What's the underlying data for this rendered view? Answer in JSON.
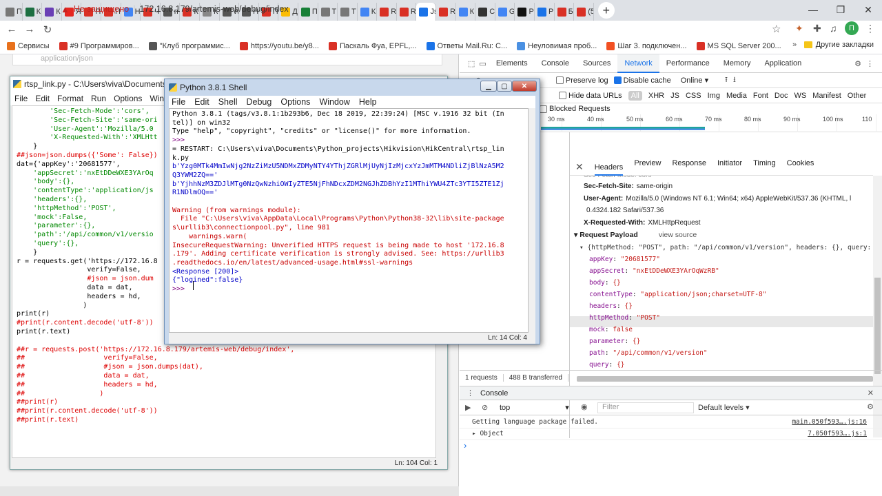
{
  "browser": {
    "tabs": [
      {
        "label": "П",
        "color": "#777"
      },
      {
        "label": "К",
        "color": "#1d6f42"
      },
      {
        "label": "К",
        "color": "#6a3fb5"
      },
      {
        "label": "Я",
        "color": "#e52620"
      },
      {
        "label": "П",
        "color": "#d93025"
      },
      {
        "label": "П",
        "color": "#d93025"
      },
      {
        "label": "Н",
        "color": "#4285f4"
      },
      {
        "label": "Ч",
        "color": "#d93025"
      },
      {
        "label": "п",
        "color": "#555"
      },
      {
        "label": "К",
        "color": "#d93025"
      },
      {
        "label": "К",
        "color": "#888"
      },
      {
        "label": "W",
        "color": "#555"
      },
      {
        "label": "Н",
        "color": "#555"
      },
      {
        "label": "П",
        "color": "#d93025"
      },
      {
        "label": "Д",
        "color": "#fbbc04"
      },
      {
        "label": "П",
        "color": "#188038"
      },
      {
        "label": "Т",
        "color": "#777"
      },
      {
        "label": "Т",
        "color": "#777"
      },
      {
        "label": "К",
        "color": "#4285f4"
      },
      {
        "label": "R",
        "color": "#d93025"
      },
      {
        "label": "R",
        "color": "#d93025"
      },
      {
        "label": "Js",
        "color": "#1a73e8"
      },
      {
        "label": "Ri",
        "color": "#d93025"
      },
      {
        "label": "К",
        "color": "#4285f4"
      },
      {
        "label": "С",
        "color": "#333"
      },
      {
        "label": "G",
        "color": "#4285f4"
      },
      {
        "label": "Р",
        "color": "#111"
      },
      {
        "label": "Р",
        "color": "#1a73e8"
      },
      {
        "label": "Б",
        "color": "#d93025"
      },
      {
        "label": "(5",
        "color": "#d93025"
      }
    ],
    "active_tab_index": 21,
    "new_tab_label": "+",
    "win_min": "—",
    "win_max": "❐",
    "win_close": "✕",
    "address": {
      "security_label": "Не защищено",
      "url": "172.16.8.179/artemis-web/debug/index"
    },
    "avatar_letter": "П",
    "bookmarks": [
      {
        "label": "Сервисы",
        "color": "#e8711c"
      },
      {
        "label": "#9 Программиров...",
        "color": "#d93025"
      },
      {
        "label": "\"Клуб программис...",
        "color": "#555"
      },
      {
        "label": "https://youtu.be/y8...",
        "color": "#d93025"
      },
      {
        "label": "Паскаль Фуа, EPFL,...",
        "color": "#d93025"
      },
      {
        "label": "Ответы Mail.Ru: С...",
        "color": "#1a73e8"
      },
      {
        "label": "Неуловимая проб...",
        "color": "#4a90e2"
      },
      {
        "label": "Шаг 3. подключен...",
        "color": "#f25022"
      },
      {
        "label": "MS SQL Server 200...",
        "color": "#d93025"
      }
    ],
    "other_bookmarks": "Другие закладки",
    "page_field_text": "application/json"
  },
  "devtools": {
    "tabs": [
      "Elements",
      "Console",
      "Sources",
      "Network",
      "Performance",
      "Memory",
      "Application"
    ],
    "active_tab": "Network",
    "preserve_log": "Preserve log",
    "disable_cache": "Disable cache",
    "throttle": "Online",
    "hide_data_urls": "Hide data URLs",
    "all": "All",
    "filters": [
      "XHR",
      "JS",
      "CSS",
      "Img",
      "Media",
      "Font",
      "Doc",
      "WS",
      "Manifest",
      "Other"
    ],
    "blocked_requests": "Blocked Requests",
    "ticks": [
      "30 ms",
      "40 ms",
      "50 ms",
      "60 ms",
      "70 ms",
      "80 ms",
      "90 ms",
      "100 ms",
      "110"
    ],
    "detail_tabs": [
      "Headers",
      "Preview",
      "Response",
      "Initiator",
      "Timing",
      "Cookies"
    ],
    "headers": [
      {
        "k": "Sec-Fetch-Site:",
        "v": "same-origin"
      },
      {
        "k": "User-Agent:",
        "v": "Mozilla/5.0 (Windows NT 6.1; Win64; x64) AppleWebKit/537.36 (KHTML, l"
      },
      {
        "k": "",
        "v": "0.4324.182 Safari/537.36"
      },
      {
        "k": "X-Requested-With:",
        "v": "XMLHttpRequest"
      }
    ],
    "request_payload": "Request Payload",
    "view_source": "view source",
    "payload_summary": "{httpMethod: \"POST\", path: \"/api/common/v1/version\", headers: {}, query: {}, pa",
    "payload": [
      {
        "k": "appKey",
        "v": "\"20681577\""
      },
      {
        "k": "appSecret",
        "v": "\"nxEtDDeWXE3YArOqWzRB\""
      },
      {
        "k": "body",
        "v": "{}"
      },
      {
        "k": "contentType",
        "v": "\"application/json;charset=UTF-8\""
      },
      {
        "k": "headers",
        "v": "{}"
      },
      {
        "k": "httpMethod",
        "v": "\"POST\""
      },
      {
        "k": "mock",
        "v": "false"
      },
      {
        "k": "parameter",
        "v": "{}"
      },
      {
        "k": "path",
        "v": "\"/api/common/v1/version\""
      },
      {
        "k": "query",
        "v": "{}"
      }
    ],
    "status": {
      "requests": "1 requests",
      "transferred": "488 B transferred"
    },
    "console_title": "Console",
    "console_context": "top",
    "console_filter": "Filter",
    "console_levels": "Default levels ▾",
    "console_messages": [
      {
        "msg": "Getting language package failed.",
        "src": "main.050f593….js:16"
      },
      {
        "msg": "▸ Object",
        "src": "7.050f593….js:1"
      }
    ],
    "prompt": "›"
  },
  "editor": {
    "title": "rtsp_link.py - C:\\Users\\viva\\Documents\\",
    "menu": [
      "File",
      "Edit",
      "Format",
      "Run",
      "Options",
      "Win"
    ],
    "lines": [
      {
        "t": "        'Sec-Fetch-Mode':'cors',",
        "cls": "s"
      },
      {
        "t": "        'Sec-Fetch-Site':'same-ori",
        "cls": "s"
      },
      {
        "t": "        'User-Agent':'Mozilla/5.0",
        "cls": "s"
      },
      {
        "t": "        'X-Requested-With':'XMLHtt",
        "cls": "s"
      },
      {
        "t": "    }",
        "cls": ""
      },
      {
        "t": "##json=json.dumps({'Some': False})",
        "cls": "c"
      },
      {
        "t": "dat={'appKey':'20681577',",
        "cls": ""
      },
      {
        "t": "    'appSecret':'nxEtDDeWXE3YArOq",
        "cls": "s"
      },
      {
        "t": "    'body':{},",
        "cls": "s"
      },
      {
        "t": "    'contentType':'application/js",
        "cls": "s"
      },
      {
        "t": "    'headers':{},",
        "cls": "s"
      },
      {
        "t": "    'httpMethod':'POST',",
        "cls": "s"
      },
      {
        "t": "    'mock':False,",
        "cls": "s"
      },
      {
        "t": "    'parameter':{},",
        "cls": "s"
      },
      {
        "t": "    'path':'/api/common/v1/versio",
        "cls": "s"
      },
      {
        "t": "    'query':{},",
        "cls": "s"
      },
      {
        "t": "    }",
        "cls": ""
      },
      {
        "t": "r = requests.get('https://172.16.8",
        "cls": ""
      },
      {
        "t": "                 verify=False,",
        "cls": ""
      },
      {
        "t": "                 #json = json.dum",
        "cls": "c"
      },
      {
        "t": "                 data = dat,",
        "cls": ""
      },
      {
        "t": "                 headers = hd,",
        "cls": ""
      },
      {
        "t": "                )",
        "cls": ""
      },
      {
        "t": "print(r)",
        "cls": ""
      },
      {
        "t": "#print(r.content.decode('utf-8'))",
        "cls": "c"
      },
      {
        "t": "print(r.text)",
        "cls": ""
      },
      {
        "t": "",
        "cls": ""
      },
      {
        "t": "##r = requests.post('https://172.16.8.179/artemis-web/debug/index',",
        "cls": "c"
      },
      {
        "t": "##                   verify=False,",
        "cls": "c"
      },
      {
        "t": "##                   #json = json.dumps(dat),",
        "cls": "c"
      },
      {
        "t": "##                   data = dat,",
        "cls": "c"
      },
      {
        "t": "##                   headers = hd,",
        "cls": "c"
      },
      {
        "t": "##                  )",
        "cls": "c"
      },
      {
        "t": "##print(r)",
        "cls": "c"
      },
      {
        "t": "##print(r.content.decode('utf-8'))",
        "cls": "c"
      },
      {
        "t": "##print(r.text)",
        "cls": "c"
      }
    ],
    "status": "Ln: 104   Col: 1"
  },
  "shell": {
    "title": "Python 3.8.1 Shell",
    "menu": [
      "File",
      "Edit",
      "Shell",
      "Debug",
      "Options",
      "Window",
      "Help"
    ],
    "lines": [
      {
        "t": "Python 3.8.1 (tags/v3.8.1:1b293b6, Dec 18 2019, 22:39:24) [MSC v.1916 32 bit (In",
        "cls": ""
      },
      {
        "t": "tel)] on win32",
        "cls": ""
      },
      {
        "t": "Type \"help\", \"copyright\", \"credits\" or \"license()\" for more information.",
        "cls": ""
      },
      {
        "t": ">>> ",
        "cls": "purple"
      },
      {
        "t": "= RESTART: C:\\Users\\viva\\Documents\\Python_projects\\Hikvision\\HikCentral\\rtsp_lin",
        "cls": ""
      },
      {
        "t": "k.py",
        "cls": ""
      },
      {
        "t": "b'Yzg0MTk4MmIwNjg2NzZiMzU5NDMxZDMyNTY4YThjZGRlMjUyNjIzMjcxYzJmMTM4NDliZjBlNzA5M2",
        "cls": "blue"
      },
      {
        "t": "Q3YWM2ZQ=='",
        "cls": "blue"
      },
      {
        "t": "b'YjhhNzM3ZDJlMTg0NzQwNzhiOWIyZTE5NjFhNDcxZDM2NGJhZDBhYzI1MThiYWU4ZTc3YTI5ZTE1Zj",
        "cls": "blue"
      },
      {
        "t": "R1NDlmOQ=='",
        "cls": "blue"
      },
      {
        "t": "",
        "cls": ""
      },
      {
        "t": "Warning (from warnings module):",
        "cls": "red"
      },
      {
        "t": "  File \"C:\\Users\\viva\\AppData\\Local\\Programs\\Python\\Python38-32\\lib\\site-package",
        "cls": "red"
      },
      {
        "t": "s\\urllib3\\connectionpool.py\", line 981",
        "cls": "red"
      },
      {
        "t": "    warnings.warn(",
        "cls": "red"
      },
      {
        "t": "InsecureRequestWarning: Unverified HTTPS request is being made to host '172.16.8",
        "cls": "red"
      },
      {
        "t": ".179'. Adding certificate verification is strongly advised. See: https://urllib3",
        "cls": "red"
      },
      {
        "t": ".readthedocs.io/en/latest/advanced-usage.html#ssl-warnings",
        "cls": "red"
      },
      {
        "t": "<Response [200]>",
        "cls": "blue"
      },
      {
        "t": "{\"logined\":false}",
        "cls": "blue"
      },
      {
        "t": ">>> ",
        "cls": "purple"
      }
    ],
    "status": "Ln: 14   Col: 4"
  }
}
